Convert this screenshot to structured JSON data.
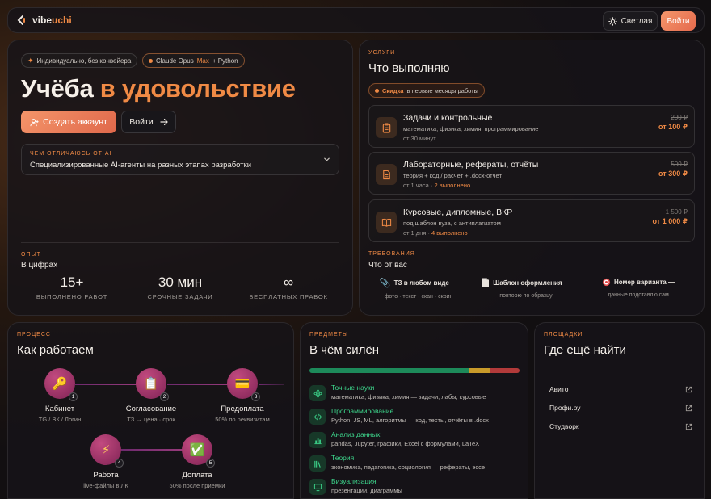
{
  "topbar": {
    "logo_main": "vibe",
    "logo_accent": "uchi",
    "theme_label": "Светлая",
    "login_label": "Войти"
  },
  "hero": {
    "badge_individual": "Индивидуально, без конвейера",
    "badge_tech_a": "Claude Opus",
    "badge_tech_b": "Max",
    "badge_tech_c": "+ Python",
    "title_main": "Учёба",
    "title_accent": "в удовольствие",
    "create_label": "Создать аккаунт",
    "enter_label": "Войти",
    "accordion_kicker": "Чем отличаюсь от AI",
    "accordion_text": "Специализированные AI-агенты на разных этапах разработки",
    "experience_kicker": "Опыт",
    "experience_title": "В цифрах",
    "stats": [
      {
        "value": "15+",
        "label": "Выполнено работ"
      },
      {
        "value": "30 мин",
        "label": "Срочные задачи"
      },
      {
        "value": "∞",
        "label": "Бесплатных правок"
      }
    ]
  },
  "services": {
    "kicker": "Услуги",
    "title": "Что выполняю",
    "sale_highlight": "Скидка",
    "sale_text": "в первые месяцы работы",
    "items": [
      {
        "name": "Задачи и контрольные",
        "desc": "математика, физика, химия, программирование",
        "time": "от 30 минут",
        "done": "",
        "old_price": "200 ₽",
        "price": "от 100 ₽",
        "icon": "clipboard-icon"
      },
      {
        "name": "Лабораторные, рефераты, отчёты",
        "desc": "теория + код / расчёт + .docx-отчёт",
        "time": "от 1 часа",
        "done": "2 выполнено",
        "old_price": "500 ₽",
        "price": "от 300 ₽",
        "icon": "document-icon"
      },
      {
        "name": "Курсовые, дипломные, ВКР",
        "desc": "под шаблон вуза, с антиплагиатом",
        "time": "от 1 дня",
        "done": "4 выполнено",
        "old_price": "1 500 ₽",
        "price": "от 1 000 ₽",
        "icon": "book-icon"
      }
    ],
    "req_kicker": "Требования",
    "req_title": "Что от вас",
    "requirements": [
      {
        "title": "ТЗ в любом виде —",
        "sub": "фото · текст · скан · скрин",
        "icon": "paperclip-icon"
      },
      {
        "title": "Шаблон оформления —",
        "sub": "повторю по образцу",
        "icon": "page-icon"
      },
      {
        "title": "Номер варианта —",
        "sub": "данные подставлю сам",
        "icon": "target-icon"
      }
    ]
  },
  "process": {
    "kicker": "Процесс",
    "title": "Как работаем",
    "steps": [
      {
        "num": "1",
        "title": "Кабинет",
        "sub": "TG / ВК / Логин",
        "icon": "key-icon",
        "glyph": "🔑"
      },
      {
        "num": "2",
        "title": "Согласование",
        "sub": "ТЗ → цена · срок",
        "icon": "clipboard-icon",
        "glyph": "📋"
      },
      {
        "num": "3",
        "title": "Предоплата",
        "sub": "50% по реквизитам",
        "icon": "card-icon",
        "glyph": "💳"
      },
      {
        "num": "4",
        "title": "Работа",
        "sub": "live-файлы в ЛК",
        "icon": "lightning-icon",
        "glyph": "⚡"
      },
      {
        "num": "5",
        "title": "Доплата",
        "sub": "50% после приёмки",
        "icon": "check-icon",
        "glyph": "✅"
      }
    ]
  },
  "skills": {
    "kicker": "Предметы",
    "title": "В чём силён",
    "bar_colors": [
      "#1d8a5a",
      "#c89a2a",
      "#b23a3a"
    ],
    "bar_fractions": [
      0.76,
      0.1,
      0.14
    ],
    "items": [
      {
        "name": "Точные науки",
        "desc": "математика, физика, химия — задачи, лабы, курсовые",
        "icon": "atom-icon"
      },
      {
        "name": "Программирование",
        "desc": "Python, JS, ML, алгоритмы — код, тесты, отчёты в .docx",
        "icon": "code-icon"
      },
      {
        "name": "Анализ данных",
        "desc": "pandas, Jupyter, графики, Excel с формулами, LaTeX",
        "icon": "chart-icon"
      },
      {
        "name": "Теория",
        "desc": "экономика, педагогика, социология — рефераты, эссе",
        "icon": "books-icon"
      },
      {
        "name": "Визуализация",
        "desc": "презентации, диаграммы",
        "icon": "monitor-icon"
      }
    ]
  },
  "places": {
    "kicker": "Площадки",
    "title": "Где ещё найти",
    "items": [
      {
        "name": "Авито"
      },
      {
        "name": "Профи.ру"
      },
      {
        "name": "Студворк"
      }
    ]
  }
}
